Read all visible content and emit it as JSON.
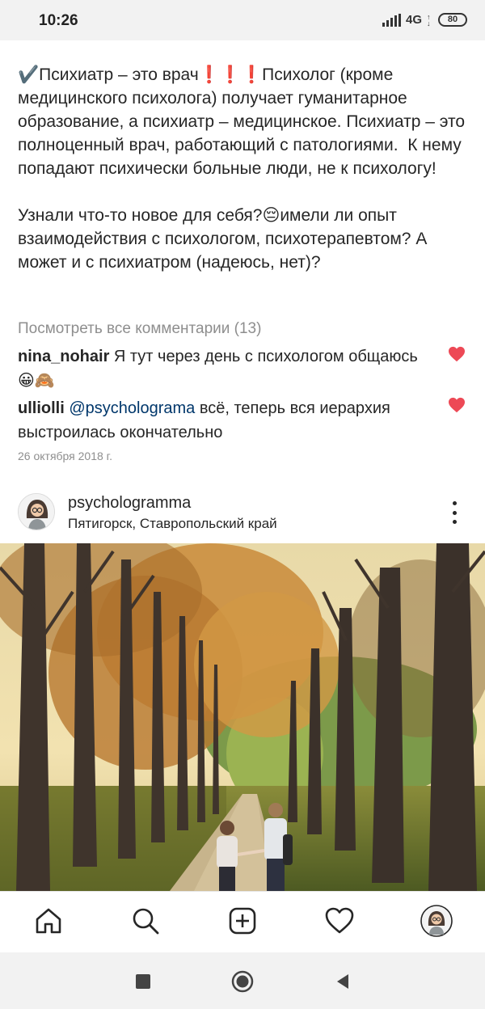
{
  "status_bar": {
    "time": "10:26",
    "network": "4G",
    "battery": "80"
  },
  "caption": {
    "paragraph1": "✔️Психиатр – это врач❗❗❗Психолог (кроме медицинского психолога) получает гуманитарное образование, а психиатр – медицинское. Психиатр – это полноценный врач, работающий с патологиями.  К нему попадают психически больные люди, не к психологу!",
    "paragraph2": "Узнали что-то новое для себя?😔имели ли опыт взаимодействия с психологом, психотерапевтом? А может и с психиатром (надеюсь, нет)?"
  },
  "view_comments_label": "Посмотреть все комментарии (13)",
  "comments": [
    {
      "user": "nina_nohair",
      "text": " Я тут через день с психологом общаюсь 😀🙈"
    },
    {
      "user": "ulliolli",
      "mention": "@psycholograma",
      "text": " всё, теперь вся иерархия выстроилась окончательно"
    }
  ],
  "post_date": "26 октября 2018 г.",
  "next_post": {
    "username": "psychologramma",
    "location": "Пятигорск, Ставропольский край"
  },
  "bottom_nav": [
    "home-icon",
    "search-icon",
    "add-post-icon",
    "activity-heart-icon",
    "profile-avatar"
  ],
  "colors": {
    "like_heart": "#ed4956",
    "mention": "#00376b",
    "muted_text": "#8e8e8e"
  }
}
